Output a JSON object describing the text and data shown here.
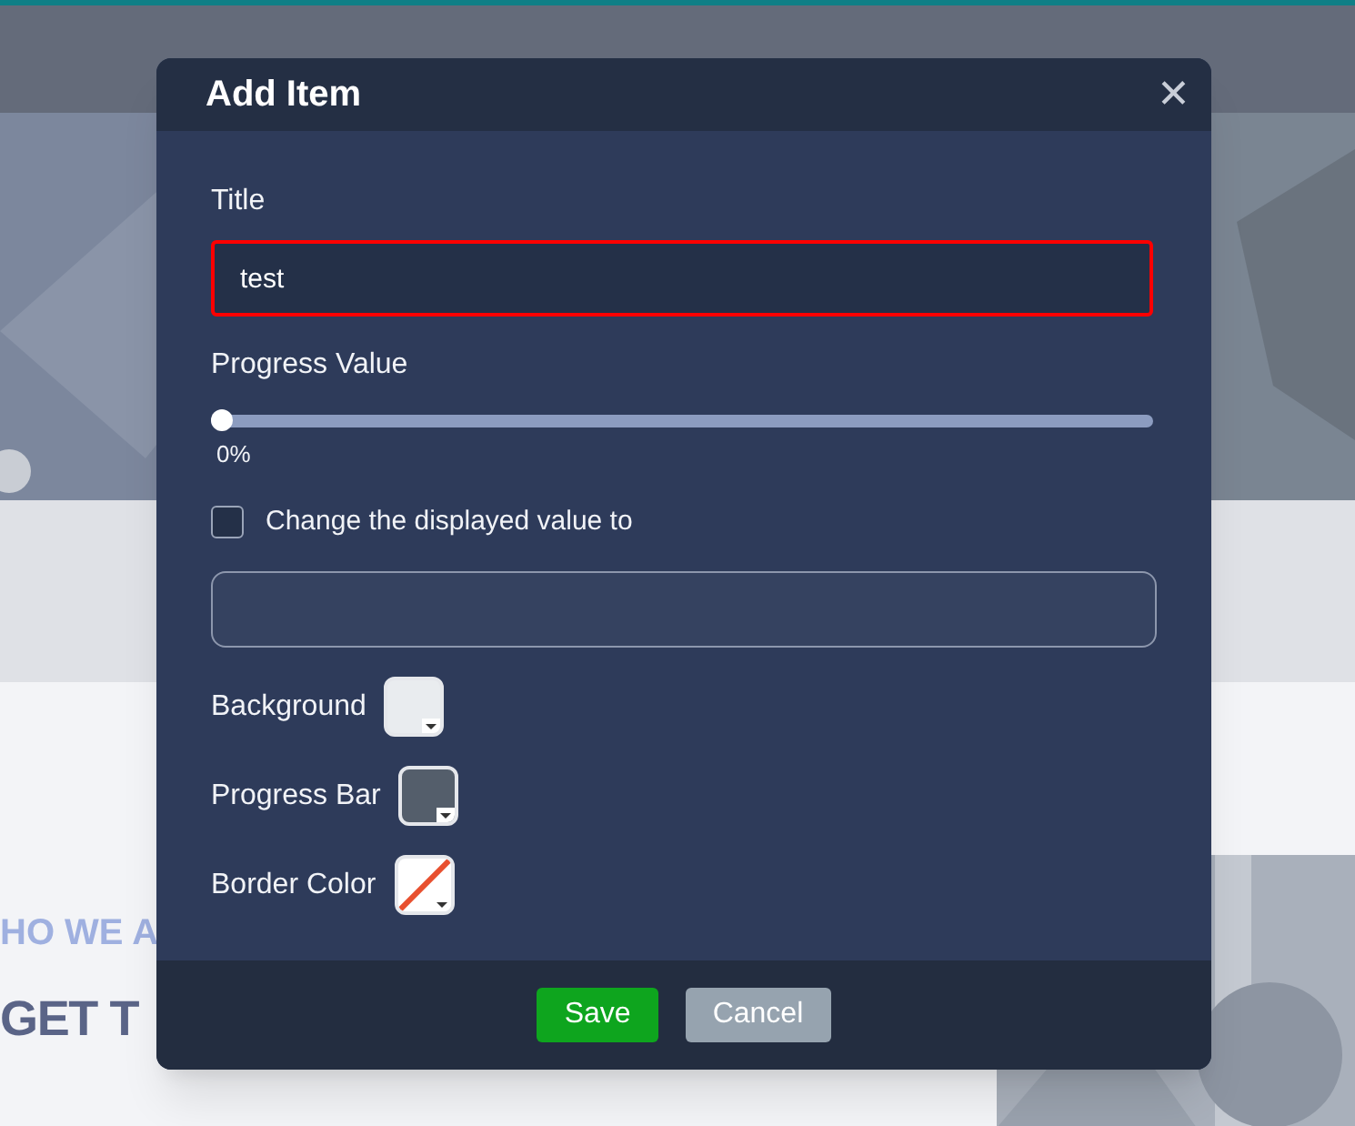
{
  "background_page": {
    "tagline": "HO WE A",
    "heading": "GET T"
  },
  "dialog": {
    "title": "Add Item",
    "close_icon": "✕",
    "title_field": {
      "label": "Title",
      "value": "test",
      "invalid": true
    },
    "progress": {
      "label": "Progress Value",
      "level": 0,
      "reading": "0%"
    },
    "override": {
      "label": "Change the displayed value to",
      "checked": false
    },
    "swatches": [
      {
        "label": "Background",
        "kind": "solid",
        "color": "#e9ecef"
      },
      {
        "label": "Progress Bar",
        "kind": "solid",
        "color": "#545e6b"
      },
      {
        "label": "Border Color",
        "kind": "none"
      }
    ],
    "buttons": [
      {
        "label": "Save",
        "kind": "primary"
      },
      {
        "label": "Cancel",
        "kind": "secondary"
      }
    ]
  }
}
